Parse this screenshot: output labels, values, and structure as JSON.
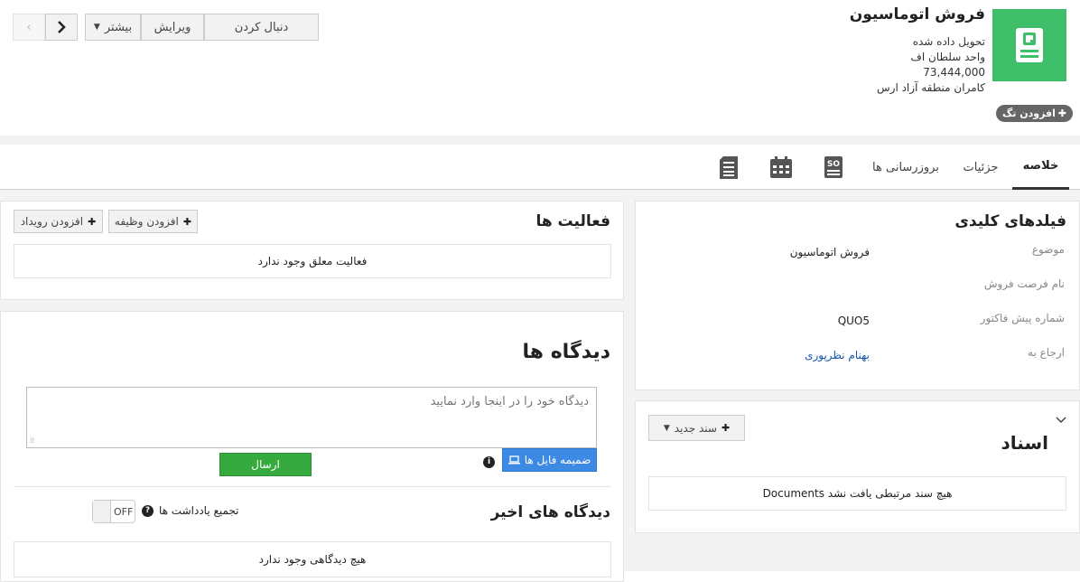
{
  "header": {
    "title": "فروش اتوماسیون",
    "lines": [
      "تحویل داده شده",
      "واحد سلطان اف",
      "73,444,000",
      "کامران منطقه آزاد ارس"
    ],
    "tag_button": "افزودن تگ",
    "buttons": {
      "follow": "دنبال کردن",
      "edit": "ویرایش",
      "more": "بیشتر"
    },
    "accent": "#3fbf6a"
  },
  "tabs": {
    "summary": "خلاصه",
    "details": "جزئیات",
    "updates": "بروزرسانی ها",
    "icons": [
      "sales-order-icon",
      "calendar-icon",
      "document-list-icon"
    ]
  },
  "key_fields": {
    "title": "فیلدهای کلیدی",
    "rows": [
      {
        "label": "موضوع",
        "value": "فروش اتوماسیون"
      },
      {
        "label": "نام فرصت فروش",
        "value": ""
      },
      {
        "label": "شماره پیش فاکتور",
        "value": "QUO5"
      },
      {
        "label": "ارجاع به",
        "value": "بهنام نظرپوری"
      }
    ],
    "link_color": "#1a56b0"
  },
  "documents": {
    "title": "اسناد",
    "new_button": "سند جدید",
    "empty_text": "هیچ سند مرتبطی یافت نشد Documents"
  },
  "activities": {
    "title": "فعالیت ها",
    "add_task": "افزودن وظیفه",
    "add_event": "افزودن رویداد",
    "empty_text": "فعالیت معلق وجود ندارد"
  },
  "comments": {
    "title": "دیدگاه ها",
    "placeholder": "دیدگاه خود را در اینجا وارد نمایید",
    "attach_button": "ضمیمه فایل ها",
    "send_button": "ارسال",
    "recent_title": "دیدگاه های اخیر",
    "rollup_label": "تجمیع یادداشت ها",
    "toggle_state": "OFF",
    "empty_text": "هیچ دیدگاهی وجود ندارد",
    "send_color": "#36a93f",
    "attach_color": "#3d8ae5"
  }
}
